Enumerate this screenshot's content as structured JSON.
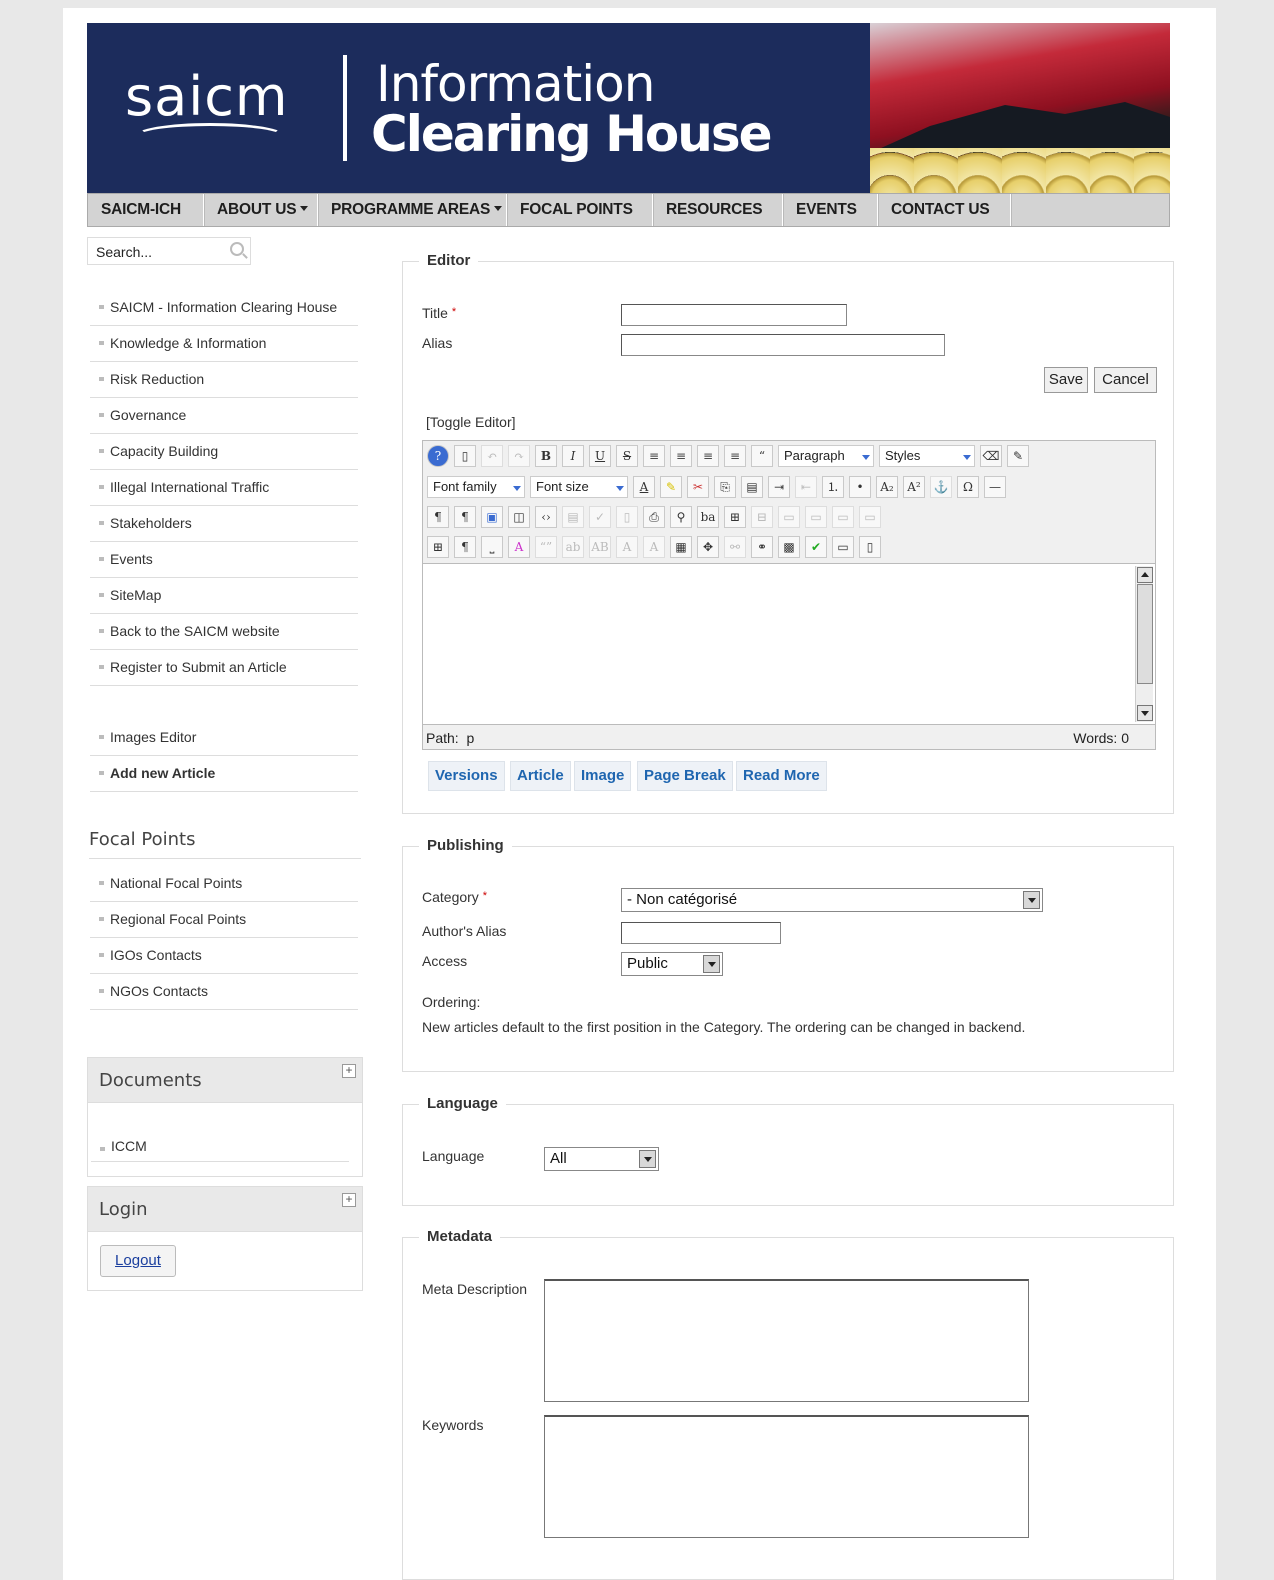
{
  "header": {
    "logo": "saicm",
    "title_line1": "Information",
    "title_line2": "Clearing House"
  },
  "nav": [
    "SAICM-ICH",
    "ABOUT US",
    "PROGRAMME AREAS",
    "FOCAL POINTS",
    "RESOURCES",
    "EVENTS",
    "CONTACT US"
  ],
  "search": {
    "placeholder": "Search..."
  },
  "sidebar": {
    "menu": [
      "SAICM - Information Clearing House",
      "Knowledge & Information",
      "Risk Reduction",
      "Governance",
      "Capacity Building",
      "Illegal International Traffic",
      "Stakeholders",
      "Events",
      "SiteMap",
      "Back to the SAICM website",
      "Register to Submit an Article"
    ],
    "user_menu": [
      "Images Editor",
      "Add new Article"
    ],
    "focal_heading": "Focal Points",
    "focal_items": [
      "National Focal Points",
      "Regional Focal Points",
      "IGOs Contacts",
      "NGOs Contacts"
    ],
    "documents_heading": "Documents",
    "documents_items": [
      "ICCM"
    ],
    "login_heading": "Login",
    "logout_label": "Logout"
  },
  "editor": {
    "legend": "Editor",
    "title_label": "Title",
    "alias_label": "Alias",
    "save_label": "Save",
    "cancel_label": "Cancel",
    "toggle_label": "[Toggle Editor]",
    "paragraph_select": "Paragraph",
    "styles_select": "Styles",
    "font_family_select": "Font family",
    "font_size_select": "Font size",
    "path_label": "Path:",
    "path_value": "p",
    "words_label": "Words: 0",
    "buttons": [
      "Versions",
      "Article",
      "Image",
      "Page Break",
      "Read More"
    ]
  },
  "publishing": {
    "legend": "Publishing",
    "category_label": "Category",
    "category_value": "- Non catégorisé",
    "author_alias_label": "Author's Alias",
    "access_label": "Access",
    "access_value": "Public",
    "ordering_label": "Ordering:",
    "ordering_note": "New articles default to the first position in the Category. The ordering can be changed in backend."
  },
  "language": {
    "legend": "Language",
    "language_label": "Language",
    "language_value": "All"
  },
  "metadata": {
    "legend": "Metadata",
    "description_label": "Meta Description",
    "keywords_label": "Keywords"
  }
}
